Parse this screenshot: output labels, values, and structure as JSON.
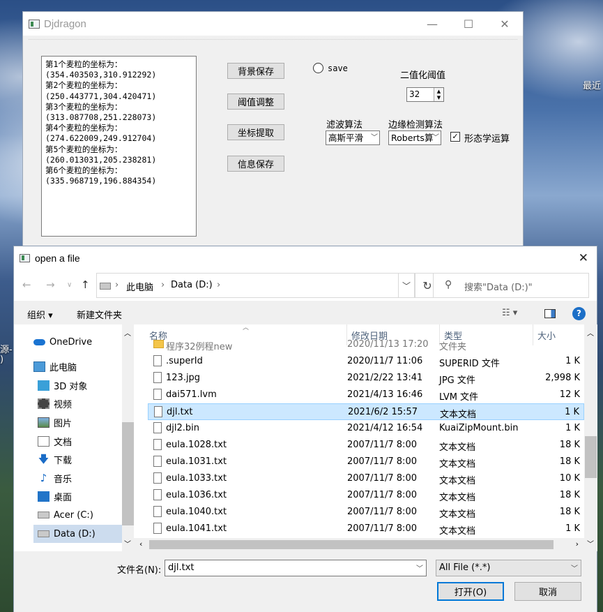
{
  "desktop": {
    "labels": [
      "最近",
      "源-",
      ")"
    ]
  },
  "app_window": {
    "title": "Djdragon",
    "controls": {
      "minimize": "—",
      "maximize": "☐",
      "close": "✕"
    },
    "coords_text": "第1个麦粒的坐标为：\n(354.403503,310.912292)\n第2个麦粒的坐标为：\n(250.443771,304.420471)\n第3个麦粒的坐标为：\n(313.087708,251.228073)\n第4个麦粒的坐标为：\n(274.622009,249.912704)\n第5个麦粒的坐标为：\n(260.013031,205.238281)\n第6个麦粒的坐标为：\n(335.968719,196.884354)",
    "buttons": [
      "背景保存",
      "阈值调整",
      "坐标提取",
      "信息保存"
    ],
    "save_radio_label": "save",
    "threshold_label": "二值化阈值",
    "threshold_value": "32",
    "filter_label": "滤波算法",
    "filter_value": "高斯平滑",
    "edge_label": "边缘检测算法",
    "edge_value": "Roberts算",
    "morph_label": "形态学运算",
    "morph_checked": true
  },
  "dialog": {
    "title": "open a file",
    "breadcrumb": [
      "此电脑",
      "Data (D:)"
    ],
    "search_placeholder": "搜索\"Data (D:)\"",
    "toolbar": {
      "organize": "组织 ▾",
      "new_folder": "新建文件夹"
    },
    "nav_items": [
      {
        "label": "OneDrive",
        "icon": "cloud-icon"
      },
      {
        "label": "此电脑",
        "icon": "computer-icon"
      },
      {
        "label": "3D 对象",
        "icon": "cube-icon"
      },
      {
        "label": "视频",
        "icon": "video-icon"
      },
      {
        "label": "图片",
        "icon": "picture-icon"
      },
      {
        "label": "文档",
        "icon": "document-icon"
      },
      {
        "label": "下载",
        "icon": "download-icon"
      },
      {
        "label": "音乐",
        "icon": "music-icon"
      },
      {
        "label": "桌面",
        "icon": "desktop-icon"
      },
      {
        "label": "Acer (C:)",
        "icon": "drive-icon"
      },
      {
        "label": "Data (D:)",
        "icon": "drive-icon"
      }
    ],
    "columns": [
      "名称",
      "修改日期",
      "类型",
      "大小"
    ],
    "files": [
      {
        "name": "程序32例程new",
        "date": "2020/11/13 17:20",
        "type": "文件夹",
        "size": ""
      },
      {
        "name": ".superId",
        "date": "2020/11/7 11:06",
        "type": "SUPERID 文件",
        "size": "1 K"
      },
      {
        "name": "123.jpg",
        "date": "2021/2/22 13:41",
        "type": "JPG 文件",
        "size": "2,998 K"
      },
      {
        "name": "dai571.lvm",
        "date": "2021/4/13 16:46",
        "type": "LVM 文件",
        "size": "12 K"
      },
      {
        "name": "djl.txt",
        "date": "2021/6/2 15:57",
        "type": "文本文档",
        "size": "1 K"
      },
      {
        "name": "djl2.bin",
        "date": "2021/4/12 16:54",
        "type": "KuaiZipMount.bin",
        "size": "1 K"
      },
      {
        "name": "eula.1028.txt",
        "date": "2007/11/7 8:00",
        "type": "文本文档",
        "size": "18 K"
      },
      {
        "name": "eula.1031.txt",
        "date": "2007/11/7 8:00",
        "type": "文本文档",
        "size": "18 K"
      },
      {
        "name": "eula.1033.txt",
        "date": "2007/11/7 8:00",
        "type": "文本文档",
        "size": "10 K"
      },
      {
        "name": "eula.1036.txt",
        "date": "2007/11/7 8:00",
        "type": "文本文档",
        "size": "18 K"
      },
      {
        "name": "eula.1040.txt",
        "date": "2007/11/7 8:00",
        "type": "文本文档",
        "size": "18 K"
      },
      {
        "name": "eula.1041.txt",
        "date": "2007/11/7 8:00",
        "type": "文本文档",
        "size": "1 K"
      }
    ],
    "filename_label": "文件名(N):",
    "filename_value": "djl.txt",
    "filetype_value": "All File (*.*)",
    "open_button": "打开(O)",
    "cancel_button": "取消"
  }
}
